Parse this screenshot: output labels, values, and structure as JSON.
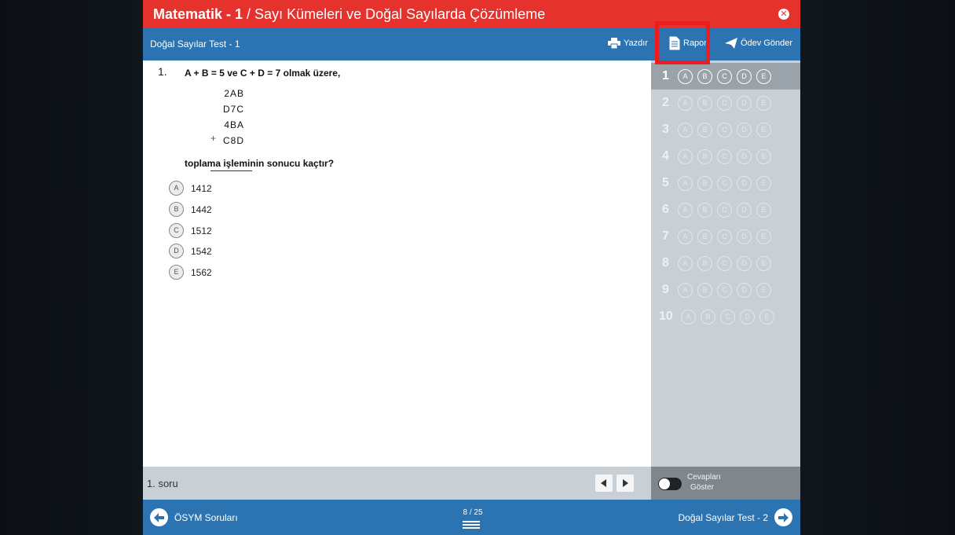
{
  "title_bar": {
    "subject": "Matematik - 1",
    "separator_topic": "/ Sayı Kümeleri ve Doğal Sayılarda Çözümleme",
    "close_icon": "close-circle-icon"
  },
  "sub_bar": {
    "test_name": "Doğal Sayılar Test - 1",
    "print_label": "Yazdır",
    "report_label": "Rapor",
    "send_label": "Ödev Gönder"
  },
  "question": {
    "number": "1.",
    "text": "A + B = 5  ve  C + D = 7  olmak üzere,",
    "sum_rows": [
      "2AB",
      "D7C",
      "4BA",
      "C8D"
    ],
    "plus_sign": "+",
    "prompt": "toplama işleminin sonucu kaçtır?",
    "options": [
      {
        "letter": "A",
        "value": "1412"
      },
      {
        "letter": "B",
        "value": "1442"
      },
      {
        "letter": "C",
        "value": "1512"
      },
      {
        "letter": "D",
        "value": "1542"
      },
      {
        "letter": "E",
        "value": "1562"
      }
    ]
  },
  "answer_sheet": {
    "rows": [
      {
        "n": "1",
        "letters": [
          "A",
          "B",
          "C",
          "D",
          "E"
        ],
        "active": true
      },
      {
        "n": "2",
        "letters": [
          "A",
          "B",
          "C",
          "D",
          "E"
        ],
        "active": false
      },
      {
        "n": "3",
        "letters": [
          "A",
          "B",
          "C",
          "D",
          "E"
        ],
        "active": false
      },
      {
        "n": "4",
        "letters": [
          "A",
          "B",
          "C",
          "D",
          "E"
        ],
        "active": false
      },
      {
        "n": "5",
        "letters": [
          "A",
          "B",
          "C",
          "D",
          "E"
        ],
        "active": false
      },
      {
        "n": "6",
        "letters": [
          "A",
          "B",
          "C",
          "D",
          "E"
        ],
        "active": false
      },
      {
        "n": "7",
        "letters": [
          "A",
          "B",
          "C",
          "D",
          "E"
        ],
        "active": false
      },
      {
        "n": "8",
        "letters": [
          "A",
          "B",
          "C",
          "D",
          "E"
        ],
        "active": false
      },
      {
        "n": "9",
        "letters": [
          "A",
          "B",
          "C",
          "D",
          "E"
        ],
        "active": false
      },
      {
        "n": "10",
        "letters": [
          "A",
          "B",
          "C",
          "D",
          "E"
        ],
        "active": false
      }
    ]
  },
  "question_footer": {
    "current": "1. soru"
  },
  "answers_toggle": {
    "label_line1": "Cevapları",
    "label_line2": "Göster",
    "on": false
  },
  "bottom_bar": {
    "prev_label": "ÖSYM Soruları",
    "page_indicator": "8 / 25",
    "next_label": "Doğal Sayılar Test - 2"
  },
  "colors": {
    "title_red": "#e5322d",
    "bar_blue": "#2b74b1",
    "panel_gray": "#c8d0d5",
    "highlight_red": "#ee1c1c"
  }
}
